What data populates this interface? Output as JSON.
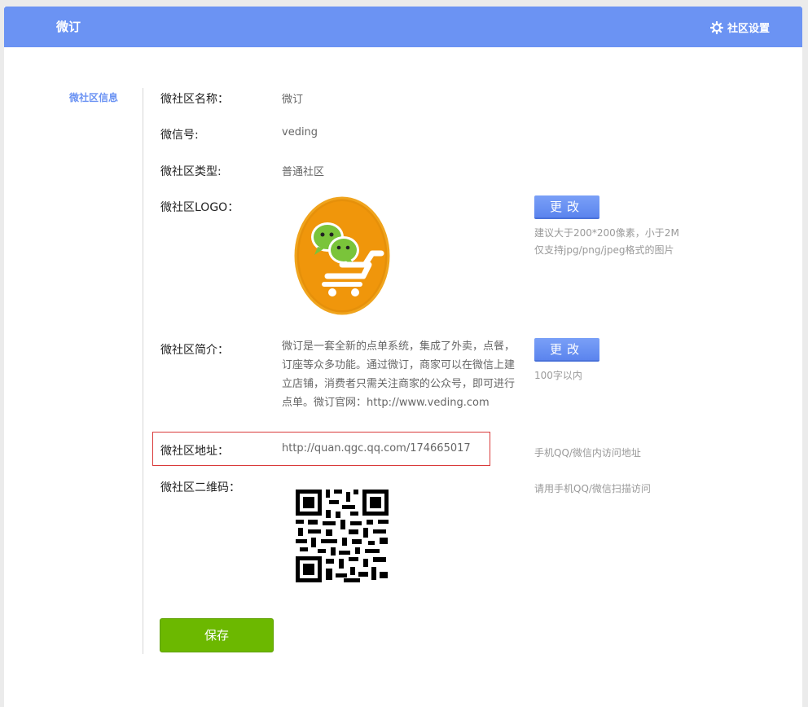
{
  "header": {
    "title": "微订",
    "settings_label": "社区设置",
    "settings_icon": "gear-icon"
  },
  "sidebar": {
    "active_item": "微社区信息"
  },
  "form": {
    "name_label": "微社区名称：",
    "name_value": "微订",
    "wechat_label": "微信号:",
    "wechat_value": "veding",
    "type_label": "微社区类型:",
    "type_value": "普通社区",
    "logo_label": "微社区LOGO：",
    "logo_change_label": "更改",
    "logo_hint_1": "建议大于200*200像素，小于2M",
    "logo_hint_2": "仅支持jpg/png/jpeg格式的图片",
    "intro_label": "微社区简介：",
    "intro_value": "微订是一套全新的点单系统，集成了外卖，点餐，订座等众多功能。通过微订，商家可以在微信上建立店铺，消费者只需关注商家的公众号，即可进行点单。微订官网：http://www.veding.com",
    "intro_change_label": "更改",
    "intro_hint": "100字以内",
    "address_label": "微社区地址：",
    "address_value": "http://quan.qgc.qq.com/174665017",
    "address_hint": "手机QQ/微信内访问地址",
    "qr_label": "微社区二维码：",
    "qr_hint": "请用手机QQ/微信扫描访问",
    "save_label": "保存"
  },
  "colors": {
    "header_bg": "#6b93f3",
    "save_green": "#6cb800",
    "highlight_red": "#d93a3a"
  }
}
